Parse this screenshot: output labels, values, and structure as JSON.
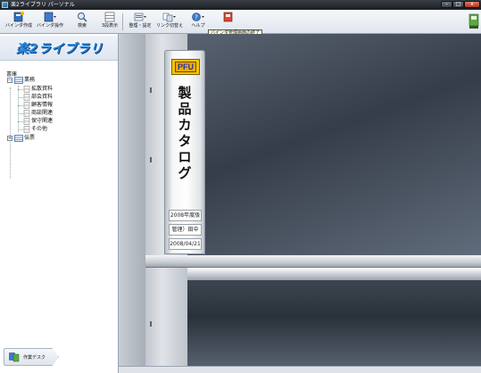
{
  "window": {
    "title": "楽2ライブラリ パーソナル",
    "buttons": {
      "minimize": "–",
      "maximize": "□",
      "close": "x"
    }
  },
  "toolbar": {
    "items": [
      {
        "label": "バインダ作成",
        "icon": "binder-create-icon"
      },
      {
        "label": "バインダ操作",
        "icon": "binder-ops-icon"
      },
      {
        "label": "検索",
        "icon": "search-icon"
      },
      {
        "label": "3段表示",
        "icon": "three-row-view-icon"
      },
      {
        "label": "整理・設定",
        "icon": "organize-settings-icon"
      },
      {
        "label": "リンク切替え",
        "icon": "link-switch-icon"
      },
      {
        "label": "ヘルプ",
        "icon": "help-icon"
      },
      {
        "label": "",
        "icon": "binder-manager-exit-icon"
      }
    ],
    "tooltip": "バインダ管理画面の終了"
  },
  "sidebar": {
    "logo": "楽2ライブラリ",
    "shelf_label": "書庫",
    "tree": [
      {
        "label": "業務",
        "expanded": true,
        "level": 0
      },
      {
        "label": "拡散資料",
        "level": 1
      },
      {
        "label": "部会資料",
        "level": 1
      },
      {
        "label": "顧客情報",
        "level": 1
      },
      {
        "label": "商談関連",
        "level": 1
      },
      {
        "label": "保守関連",
        "level": 1
      },
      {
        "label": "その他",
        "level": 1
      },
      {
        "label": "伝票",
        "expanded": false,
        "level": 0
      }
    ],
    "desk_button": "作業デスク"
  },
  "binder": {
    "logo": "PFU",
    "title": "製品カタログ",
    "year": "2008年度版",
    "manager": "管理）田中",
    "date": "2008/04/21"
  },
  "colors": {
    "accent": "#2a8be0",
    "binder_logo_bg": "#f2c500",
    "close_button": "#c8452e"
  }
}
